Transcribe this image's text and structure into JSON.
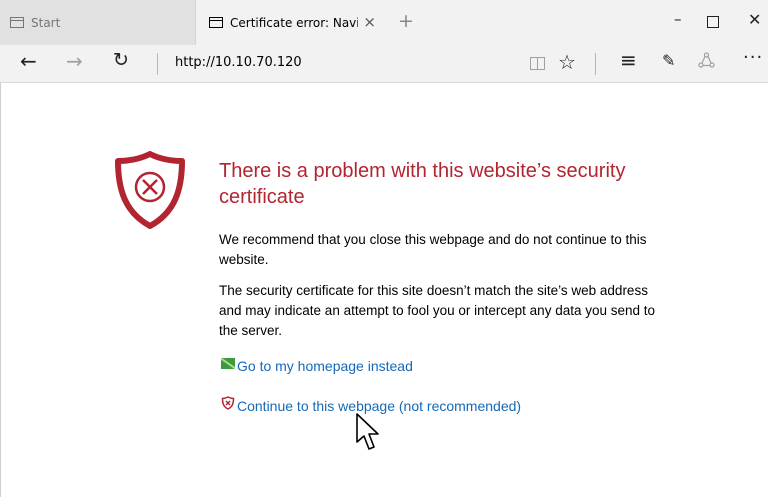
{
  "tabs": [
    {
      "title": "Start",
      "active": false
    },
    {
      "title": "Certificate error: Navigat",
      "active": true,
      "close_glyph": "×"
    }
  ],
  "window_controls": {
    "new_tab": "+",
    "minimize": "–",
    "close": "✕"
  },
  "toolbar": {
    "back": "←",
    "forward": "→",
    "refresh": "↻",
    "address": "http://10.10.70.120",
    "favorites": "☆",
    "hub": "≡",
    "make_note": "✎",
    "more": "···"
  },
  "error_page": {
    "title": "There is a problem with this website’s security certificate",
    "recommendation": "We recommend that you close this webpage and do not continue to this website.",
    "explanation": "The security certificate for this site doesn’t match the site’s web address and may indicate an attempt to fool you or intercept any data you send to the server.",
    "homepage_link": "Go to my homepage instead",
    "continue_link": "Continue to this webpage (not recommended)"
  },
  "colors": {
    "heading": "#b32431",
    "link": "#1569b8",
    "shield": "#b32431"
  },
  "icons": [
    "tab-page-icon",
    "reading-view-icon",
    "favorites-star-icon",
    "hub-icon",
    "web-note-icon",
    "share-icon",
    "more-icon",
    "shield-error-icon",
    "home-icon",
    "warning-shield-icon",
    "mouse-cursor-icon"
  ]
}
